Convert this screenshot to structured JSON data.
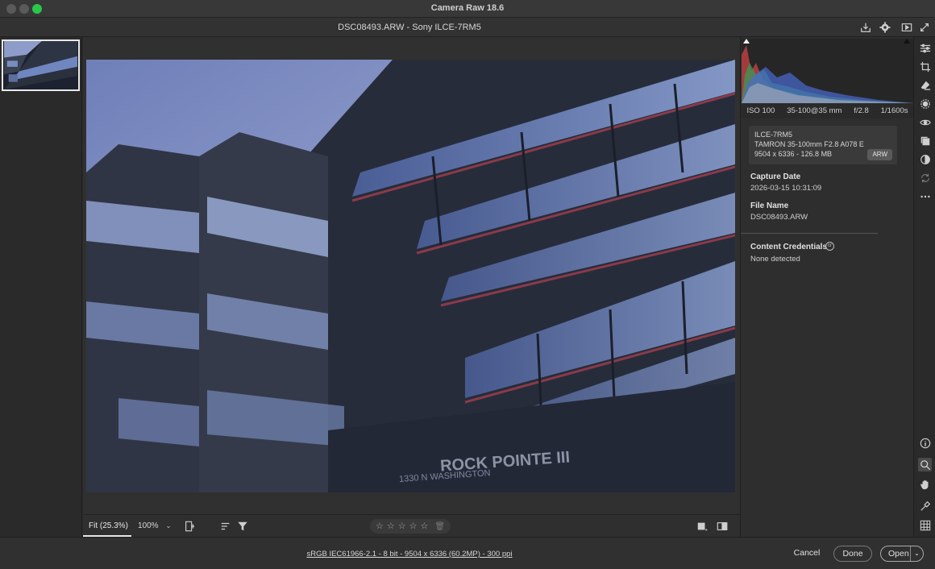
{
  "window": {
    "title": "Camera Raw 18.6"
  },
  "header": {
    "file_title": "DSC08493.ARW  -  Sony ILCE-7RM5",
    "icons": [
      "save-icon",
      "gear-icon",
      "slideshow-icon",
      "fullscreen-icon"
    ]
  },
  "viewbar": {
    "fit_label": "Fit (25.3%)",
    "zoom_label": "100%",
    "zoom_caret": "⌄",
    "stars": [
      "☆",
      "☆",
      "☆",
      "☆",
      "☆"
    ],
    "trash": "🗑"
  },
  "photo": {
    "sign_line1": "ROCK POINTE III",
    "sign_line2": "1330 N WASHINGTON"
  },
  "panel": {
    "exif": {
      "iso": "ISO 100",
      "focal": "35-100@35 mm",
      "aperture": "f/2.8",
      "shutter": "1/1600s"
    },
    "meta": {
      "camera": "ILCE-7RM5",
      "lens": "TAMRON 35-100mm F2.8 A078 E",
      "dimensions": "9504 x 6336  -  126.8 MB",
      "format_badge": "ARW"
    },
    "capture_date_label": "Capture Date",
    "capture_date_value": "2026-03-15 10:31:09",
    "file_name_label": "File Name",
    "file_name_value": "DSC08493.ARW",
    "content_credentials_label": "Content Credentials",
    "content_credentials_icon": "cr",
    "content_credentials_value": "None detected"
  },
  "footer": {
    "workflow_text": "sRGB IEC61966-2.1 - 8 bit - 9504 x 6336 (60.2MP) - 300 ppi",
    "cancel_label": "Cancel",
    "done_label": "Done",
    "open_label": "Open",
    "open_caret": "⌄"
  },
  "colors": {
    "accent_green": "#2ac84a",
    "panel_bg": "#2e2e2e",
    "sky": "#8f9cc8"
  }
}
